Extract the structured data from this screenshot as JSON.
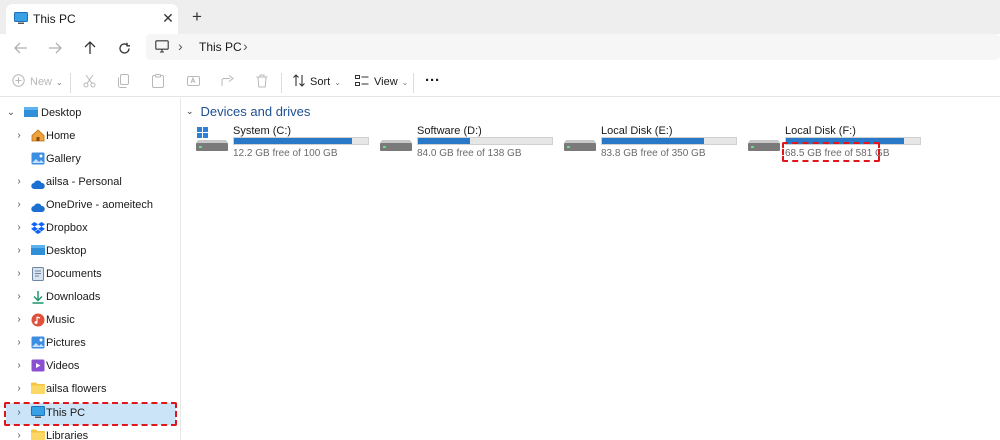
{
  "window": {
    "tab_title": "This PC",
    "tab_close": "✕",
    "new_tab": "+"
  },
  "address": {
    "crumbs": [
      "This PC"
    ],
    "separator": "›"
  },
  "toolbar": {
    "new_label": "New",
    "sort_label": "Sort",
    "view_label": "View",
    "more_label": "···"
  },
  "sidebar": {
    "items": [
      {
        "label": "Desktop",
        "icon": "desktop-icon"
      },
      {
        "label": "Home",
        "icon": "home-icon"
      },
      {
        "label": "Gallery",
        "icon": "gallery-icon"
      },
      {
        "label": "ailsa - Personal",
        "icon": "onedrive-cloud-icon"
      },
      {
        "label": "OneDrive - aomeitech",
        "icon": "onedrive-cloud-icon"
      },
      {
        "label": "Dropbox",
        "icon": "dropbox-icon"
      },
      {
        "label": "Desktop",
        "icon": "desktop-icon"
      },
      {
        "label": "Documents",
        "icon": "documents-icon"
      },
      {
        "label": "Downloads",
        "icon": "downloads-icon"
      },
      {
        "label": "Music",
        "icon": "music-icon"
      },
      {
        "label": "Pictures",
        "icon": "pictures-icon"
      },
      {
        "label": "Videos",
        "icon": "videos-icon"
      },
      {
        "label": "ailsa flowers",
        "icon": "folder-icon"
      },
      {
        "label": "This PC",
        "icon": "computer-icon",
        "selected": true
      },
      {
        "label": "Libraries",
        "icon": "folder-icon"
      }
    ]
  },
  "main": {
    "section_title": "Devices and drives",
    "drives": [
      {
        "name": "System (C:)",
        "free_text": "12.2 GB free of 100 GB",
        "used_fraction": 0.878
      },
      {
        "name": "Software (D:)",
        "free_text": "84.0 GB free of 138 GB",
        "used_fraction": 0.391
      },
      {
        "name": "Local Disk (E:)",
        "free_text": "83.8 GB free of 350 GB",
        "used_fraction": 0.761
      },
      {
        "name": "Local Disk (F:)",
        "free_text": "68.5 GB free of 581 GB",
        "used_fraction": 0.882
      }
    ]
  },
  "colors": {
    "accent": "#2a78c8",
    "selection": "#cce4f7",
    "highlight": "#e0161b",
    "section_title": "#1e4f91"
  }
}
